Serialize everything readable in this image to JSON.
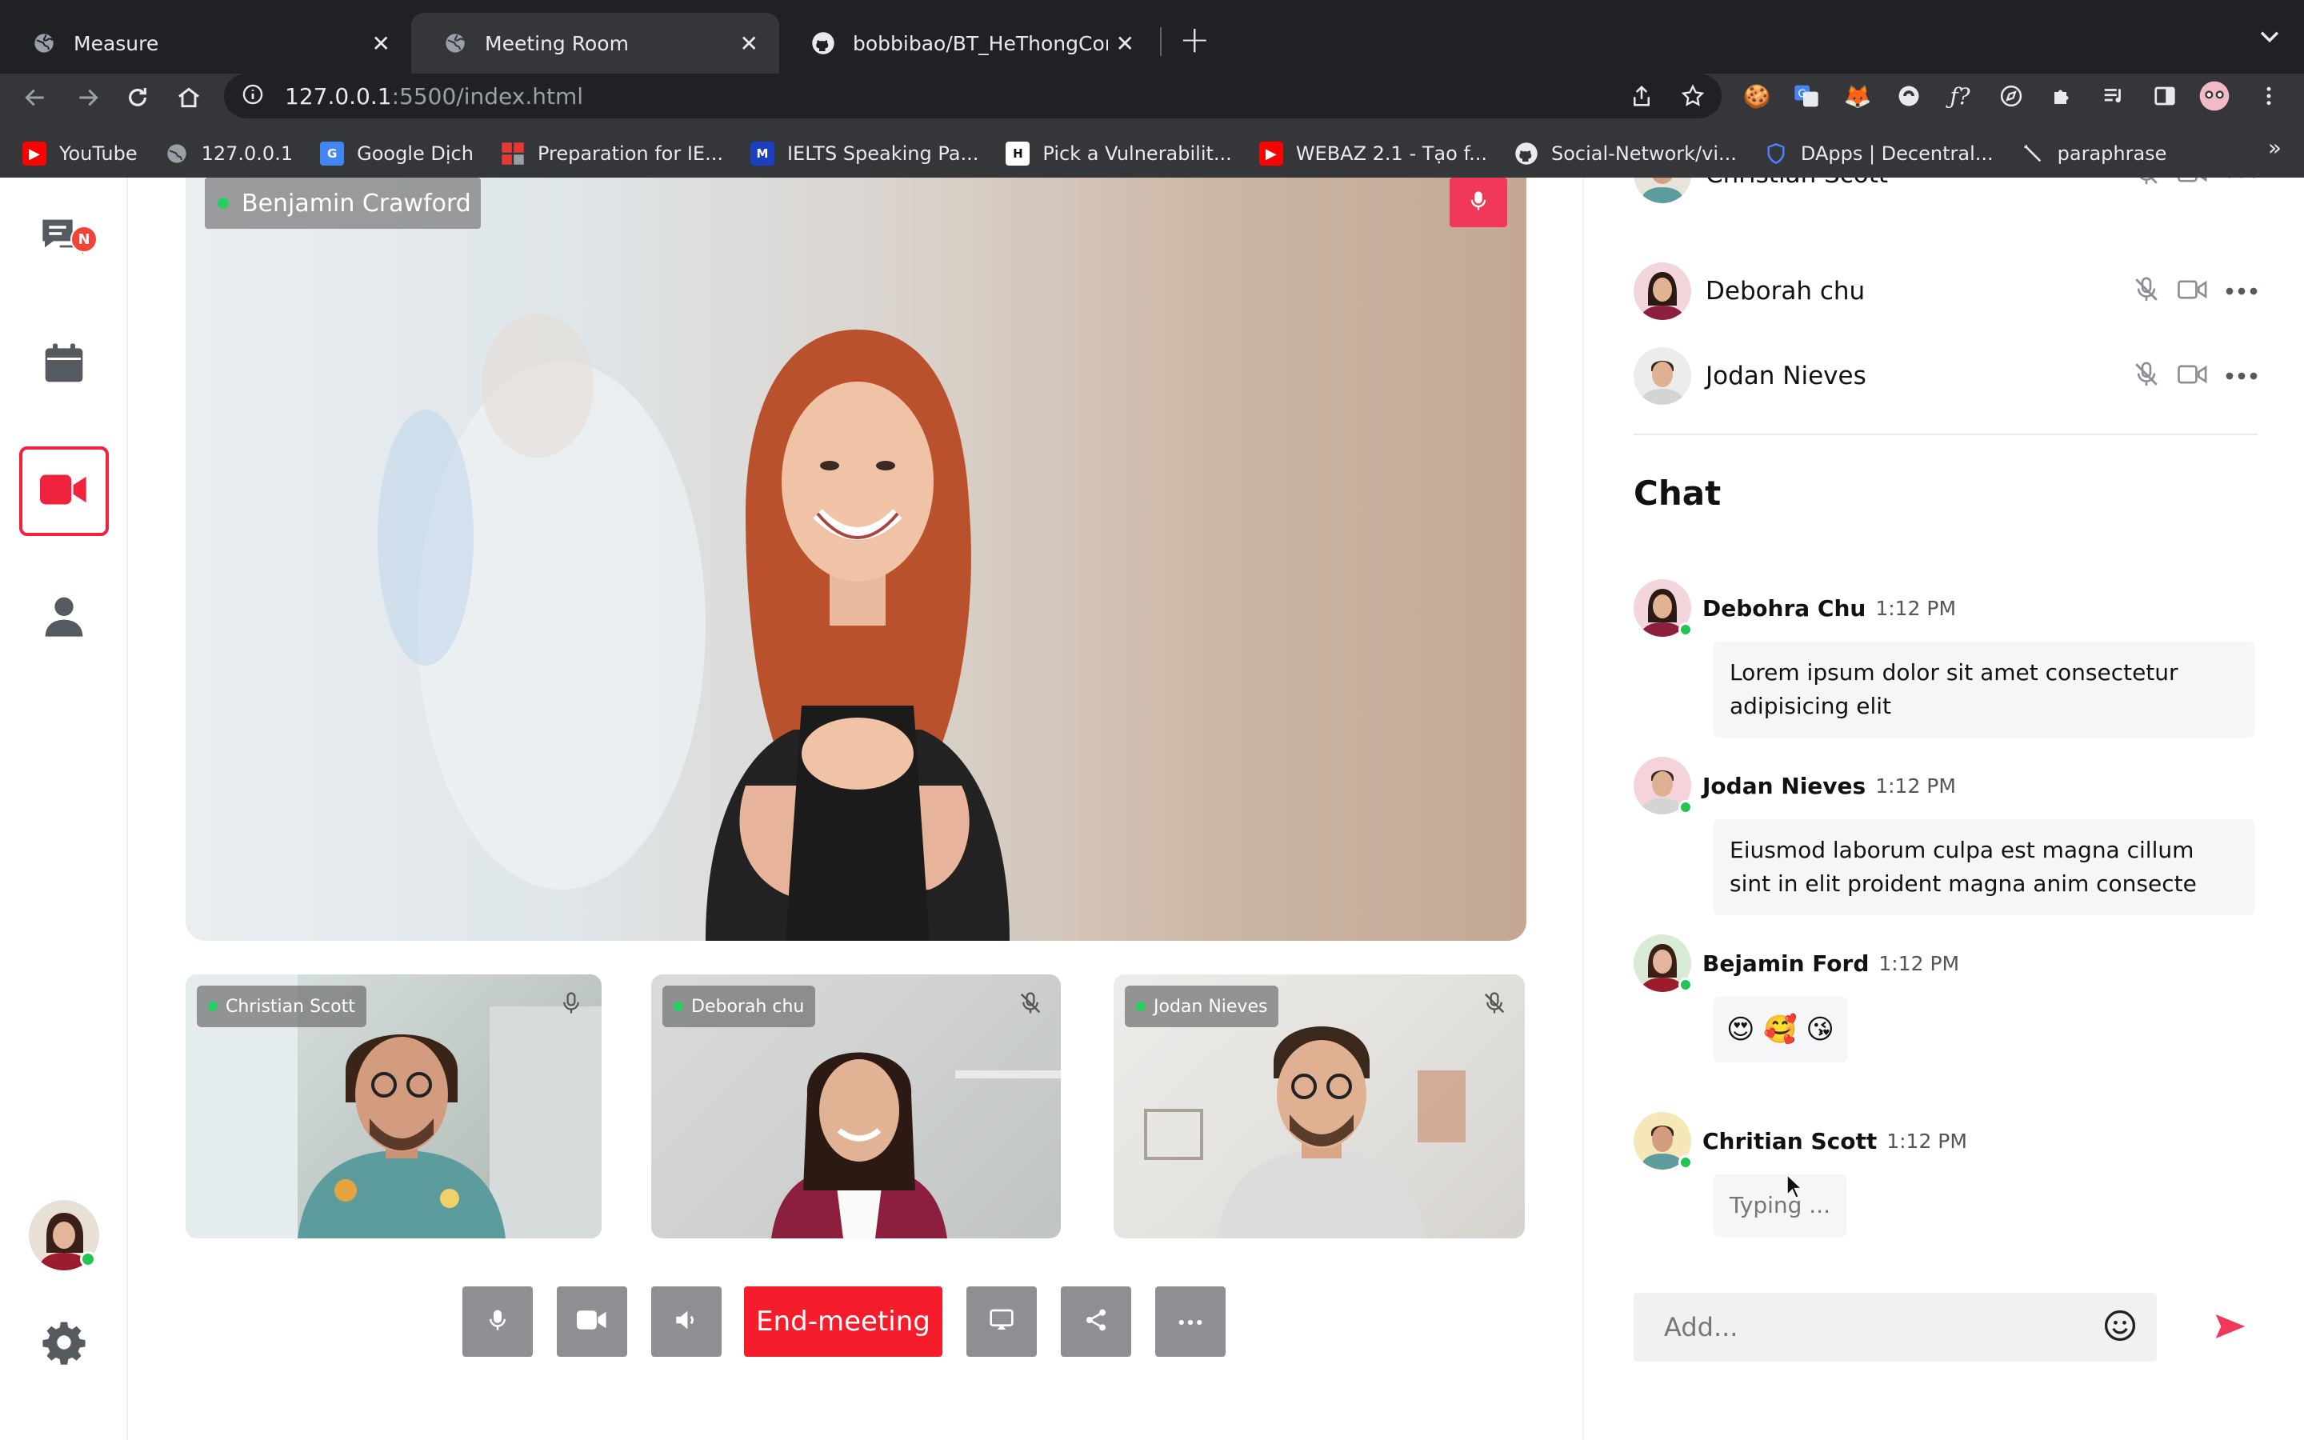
{
  "browser": {
    "tabs": [
      {
        "title": "Measure"
      },
      {
        "title": "Meeting Room"
      },
      {
        "title": "bobbibao/BT_HeThongCongNg"
      }
    ],
    "url_host": "127.0.0.1",
    "url_rest": ":5500/index.html",
    "bookmarks": [
      {
        "label": "YouTube"
      },
      {
        "label": "127.0.0.1"
      },
      {
        "label": "Google Dịch"
      },
      {
        "label": "Preparation for IE..."
      },
      {
        "label": "IELTS Speaking Pa..."
      },
      {
        "label": "Pick a Vulnerabilit..."
      },
      {
        "label": "WEBAZ 2.1 - Tạo f..."
      },
      {
        "label": "Social-Network/vi..."
      },
      {
        "label": "DApps | Decentral..."
      },
      {
        "label": "paraphrase"
      }
    ],
    "bookmarks_more": "»"
  },
  "sidebar": {
    "badge": "N"
  },
  "main_video": {
    "speaker": "Benjamin Crawford"
  },
  "tiles": [
    {
      "name": "Christian Scott"
    },
    {
      "name": "Deborah chu"
    },
    {
      "name": "Jodan Nieves"
    }
  ],
  "controls": {
    "end_label": "End-meeting"
  },
  "participants": [
    {
      "name": "Christian Scott"
    },
    {
      "name": "Deborah chu"
    },
    {
      "name": "Jodan Nieves"
    }
  ],
  "chat": {
    "title": "Chat",
    "messages": [
      {
        "name": "Debohra Chu",
        "time": "1:12 PM",
        "text": "Lorem ipsum dolor sit amet consectetur adipisicing elit"
      },
      {
        "name": "Jodan Nieves",
        "time": "1:12 PM",
        "text": "Eiusmod laborum culpa est magna cillum sint in elit proident magna anim consecte"
      },
      {
        "name": "Bejamin Ford",
        "time": "1:12 PM",
        "text": "😍 🥰 😘"
      },
      {
        "name": "Chritian Scott",
        "time": "1:12 PM",
        "text": "Typing ..."
      }
    ],
    "input_placeholder": "Add..."
  },
  "colors": {
    "accent": "#f0233f",
    "end_meeting": "#f51d2c",
    "online": "#23c552",
    "control_gray": "#8e8f93"
  },
  "icons": {
    "nav": [
      "chat-icon",
      "calendar-icon",
      "video-camera-icon",
      "user-icon",
      "settings-gear-icon"
    ],
    "controls": [
      "mic-icon",
      "camera-icon",
      "speaker-icon",
      "cast-icon",
      "share-icon",
      "more-icon"
    ],
    "participant_row": [
      "mic-muted-icon",
      "video-icon",
      "more-icon"
    ]
  }
}
